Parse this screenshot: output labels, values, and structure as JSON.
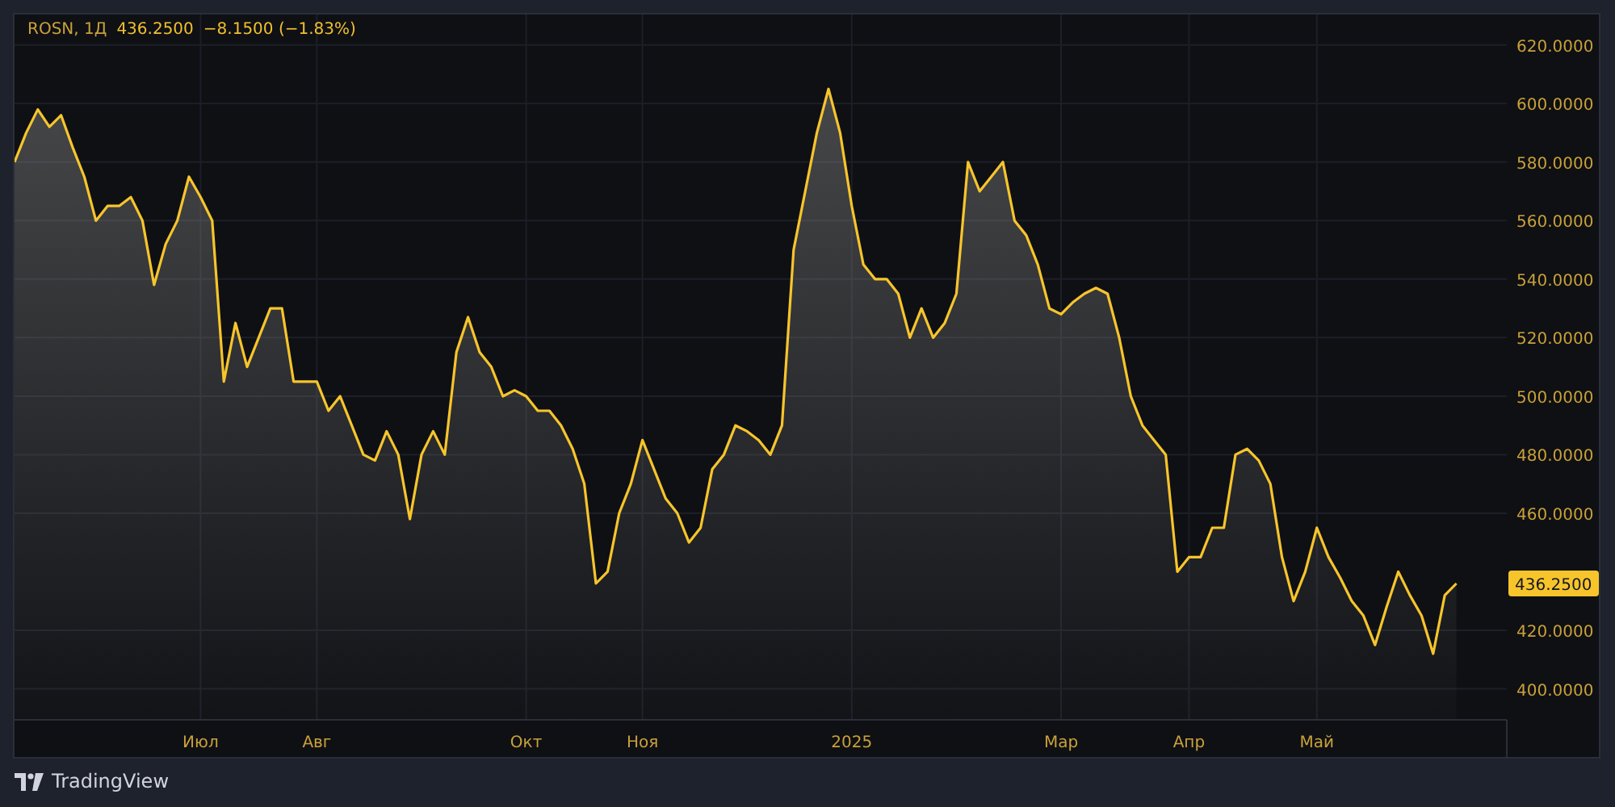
{
  "legend": {
    "symbol": "ROSN, 1Д",
    "price": "436.2500",
    "change": "−8.1500 (−1.83%)"
  },
  "chart_data": {
    "type": "area",
    "grid": true,
    "ylim": [
      389.4,
      630.4
    ],
    "yticks": [
      {
        "value": 620,
        "label": "620.0000"
      },
      {
        "value": 600,
        "label": "600.0000"
      },
      {
        "value": 580,
        "label": "580.0000"
      },
      {
        "value": 560,
        "label": "560.0000"
      },
      {
        "value": 540,
        "label": "540.0000"
      },
      {
        "value": 520,
        "label": "520.0000"
      },
      {
        "value": 500,
        "label": "500.0000"
      },
      {
        "value": 480,
        "label": "480.0000"
      },
      {
        "value": 460,
        "label": "460.0000"
      },
      {
        "value": 420,
        "label": "420.0000"
      },
      {
        "value": 400,
        "label": "400.0000"
      }
    ],
    "categories": [
      null,
      null,
      null,
      null,
      null,
      null,
      null,
      null,
      null,
      null,
      null,
      null,
      null,
      null,
      null,
      null,
      "Июл",
      null,
      null,
      null,
      null,
      null,
      null,
      null,
      null,
      null,
      "Авг",
      null,
      null,
      null,
      null,
      null,
      null,
      null,
      null,
      null,
      null,
      null,
      null,
      null,
      null,
      null,
      null,
      null,
      "Окт",
      null,
      null,
      null,
      null,
      null,
      null,
      null,
      null,
      null,
      "Ноя",
      null,
      null,
      null,
      null,
      null,
      null,
      null,
      null,
      null,
      null,
      null,
      null,
      null,
      null,
      null,
      null,
      null,
      "2025",
      null,
      null,
      null,
      null,
      null,
      null,
      null,
      null,
      null,
      null,
      null,
      null,
      null,
      null,
      null,
      null,
      null,
      "Мар",
      null,
      null,
      null,
      null,
      null,
      null,
      null,
      null,
      null,
      null,
      "Апр",
      null,
      null,
      null,
      null,
      null,
      null,
      null,
      null,
      null,
      null,
      "Май",
      null,
      null,
      null,
      null,
      null,
      null,
      null,
      null,
      null,
      null,
      null,
      null
    ],
    "series": [
      {
        "color": "#f7c52b",
        "values": [
          580,
          590,
          598,
          592,
          596,
          585,
          575,
          560,
          565,
          565,
          568,
          560,
          538,
          552,
          560,
          575,
          568,
          560,
          505,
          525,
          510,
          520,
          530,
          530,
          505,
          505,
          505,
          495,
          500,
          490,
          480,
          478,
          488,
          480,
          458,
          480,
          488,
          480,
          515,
          527,
          515,
          510,
          500,
          502,
          500,
          495,
          495,
          490,
          482,
          470,
          436,
          440,
          460,
          470,
          485,
          475,
          465,
          460,
          450,
          455,
          475,
          480,
          490,
          488,
          485,
          480,
          490,
          550,
          570,
          590,
          605,
          590,
          565,
          545,
          540,
          540,
          535,
          520,
          530,
          520,
          525,
          535,
          580,
          570,
          575,
          580,
          560,
          555,
          545,
          530,
          528,
          532,
          535,
          537,
          535,
          520,
          500,
          490,
          485,
          480,
          440,
          445,
          445,
          455,
          455,
          480,
          482,
          478,
          470,
          445,
          430,
          440,
          455,
          445,
          438,
          430,
          425,
          415,
          428,
          440,
          432,
          425,
          412,
          432,
          436
        ]
      }
    ]
  },
  "price_tag": "436.2500",
  "footer": {
    "brand": "TradingView"
  }
}
